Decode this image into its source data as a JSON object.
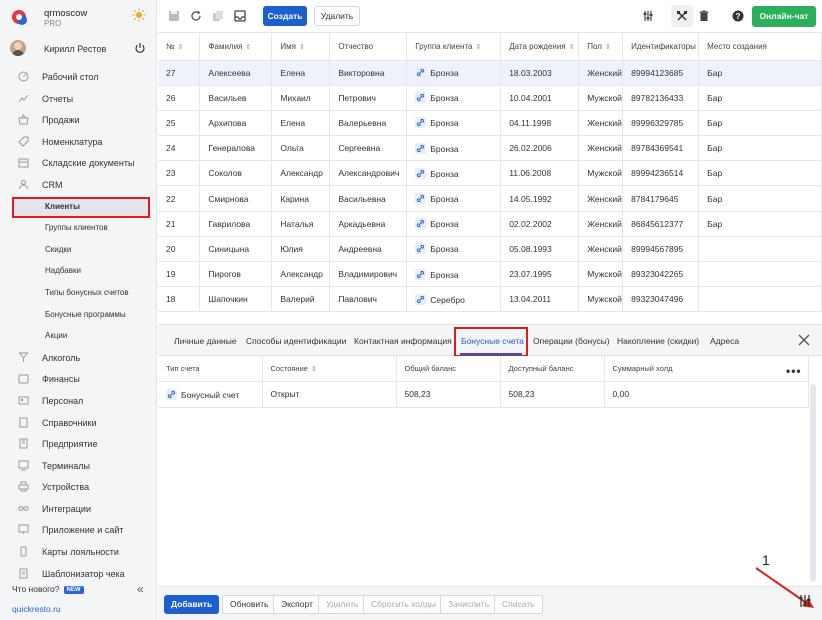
{
  "brand": {
    "name": "qrmoscow",
    "plan": "PRO"
  },
  "user": {
    "name": "Кирилл Рестов"
  },
  "nav": [
    {
      "label": "Рабочий стол"
    },
    {
      "label": "Отчеты"
    },
    {
      "label": "Продажи"
    },
    {
      "label": "Номенклатура"
    },
    {
      "label": "Складские документы"
    },
    {
      "label": "CRM"
    }
  ],
  "crm_sub": [
    "Клиенты",
    "Группы клиентов",
    "Скидки",
    "Надбавки",
    "Типы бонусных счетов",
    "Бонусные программы",
    "Акции"
  ],
  "nav2": [
    {
      "label": "Алкоголь"
    },
    {
      "label": "Финансы"
    },
    {
      "label": "Персонал"
    },
    {
      "label": "Справочники"
    },
    {
      "label": "Предприятие"
    },
    {
      "label": "Терминалы"
    },
    {
      "label": "Устройства"
    },
    {
      "label": "Интеграции"
    },
    {
      "label": "Приложение и сайт"
    },
    {
      "label": "Карты лояльности"
    },
    {
      "label": "Шаблонизатор чека"
    }
  ],
  "whatsnew": {
    "label": "Что нового?",
    "badge": "NEW"
  },
  "site_link": "quickresto.ru",
  "toolbar": {
    "create": "Создать",
    "delete": "Удалить",
    "chat": "Онлайн-чат"
  },
  "table": {
    "headers": [
      "№",
      "Фамилия",
      "Имя",
      "Отчество",
      "Группа клиента",
      "Дата рождения",
      "Пол",
      "Идентификаторы",
      "Место создания"
    ],
    "rows": [
      [
        "27",
        "Алексеева",
        "Елена",
        "Викторовна",
        "Бронза",
        "18.03.2003",
        "Женский",
        "89994123685",
        "Бар"
      ],
      [
        "26",
        "Васильев",
        "Михаил",
        "Петрович",
        "Бронза",
        "10.04.2001",
        "Мужской",
        "89782136433",
        "Бар"
      ],
      [
        "25",
        "Архипова",
        "Елена",
        "Валерьевна",
        "Бронза",
        "04.11.1998",
        "Женский",
        "89996329785",
        "Бар"
      ],
      [
        "24",
        "Генералова",
        "Ольга",
        "Сергеевна",
        "Бронза",
        "26.02.2006",
        "Женский",
        "89784369541",
        "Бар"
      ],
      [
        "23",
        "Соколов",
        "Александр",
        "Александрович",
        "Бронза",
        "11.06.2008",
        "Мужской",
        "89994236514",
        "Бар"
      ],
      [
        "22",
        "Смирнова",
        "Карина",
        "Васильевна",
        "Бронза",
        "14.05.1992",
        "Женский",
        "8784179645",
        "Бар"
      ],
      [
        "21",
        "Гаврилова",
        "Наталья",
        "Аркадьевна",
        "Бронза",
        "02.02.2002",
        "Женский",
        "86845612377",
        "Бар"
      ],
      [
        "20",
        "Синицына",
        "Юлия",
        "Андреевна",
        "Бронза",
        "05.08.1993",
        "Женский",
        "89994567895",
        ""
      ],
      [
        "19",
        "Пирогов",
        "Александр",
        "Владимирович",
        "Бронза",
        "23.07.1995",
        "Мужской",
        "89323042265",
        ""
      ],
      [
        "18",
        "Шапочкин",
        "Валерий",
        "Павлович",
        "Серебро",
        "13.04.2011",
        "Мужской",
        "89323047496",
        ""
      ]
    ]
  },
  "tabs": [
    "Личные данные",
    "Способы идентификации",
    "Контактная информация",
    "Бонусные счета",
    "Операции (бонусы)",
    "Накопление (скидки)",
    "Адреса"
  ],
  "sub_table": {
    "headers": [
      "Тип счета",
      "Состояние",
      "Общий баланс",
      "Доступный баланс",
      "Суммарный холд"
    ],
    "rows": [
      [
        "Бонусный счет",
        "Открыт",
        "508,23",
        "508,23",
        "0,00"
      ]
    ]
  },
  "bottom": {
    "add": "Добавить",
    "refresh": "Обновить",
    "export": "Экспорт",
    "remove": "Удалить",
    "reset_holds": "Сбросить холды",
    "credit": "Зачислить",
    "debit": "Списать"
  },
  "annotation": "1",
  "colors": {
    "primary": "#1d5ed0",
    "green": "#2bb05a",
    "highlight": "#e01b1b"
  }
}
